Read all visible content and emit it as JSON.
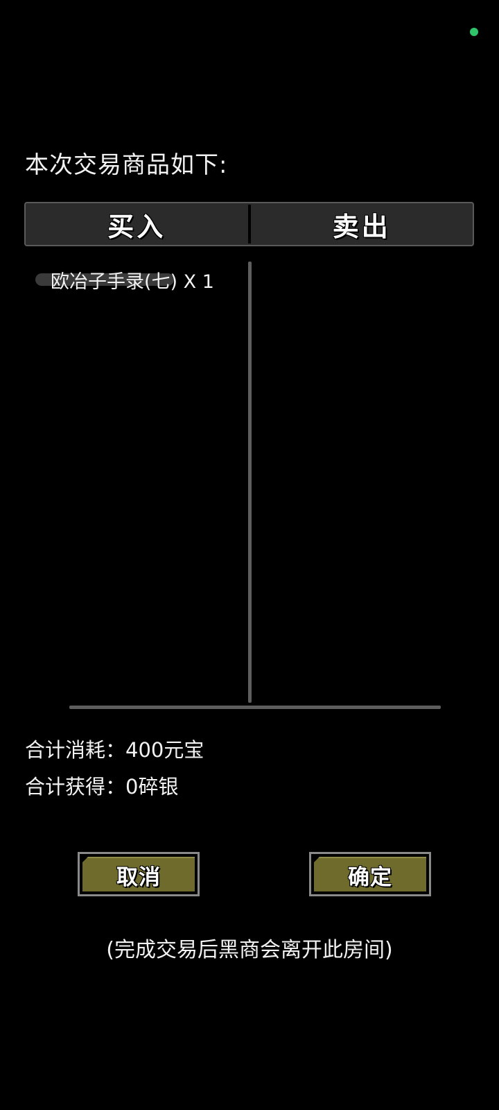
{
  "status": {
    "indicator_color": "#2fc46a"
  },
  "heading": "本次交易商品如下:",
  "tabs": [
    {
      "label": "买入"
    },
    {
      "label": "卖出"
    }
  ],
  "buy_list": [
    {
      "label": "欧冶子手录(七) X 1"
    }
  ],
  "summary": {
    "cost": "合计消耗：400元宝",
    "gain": "合计获得：0碎银"
  },
  "buttons": {
    "cancel_label": "取消",
    "confirm_label": "确定",
    "button_color": "#6e6b2d"
  },
  "footnote": "(完成交易后黑商会离开此房间)"
}
